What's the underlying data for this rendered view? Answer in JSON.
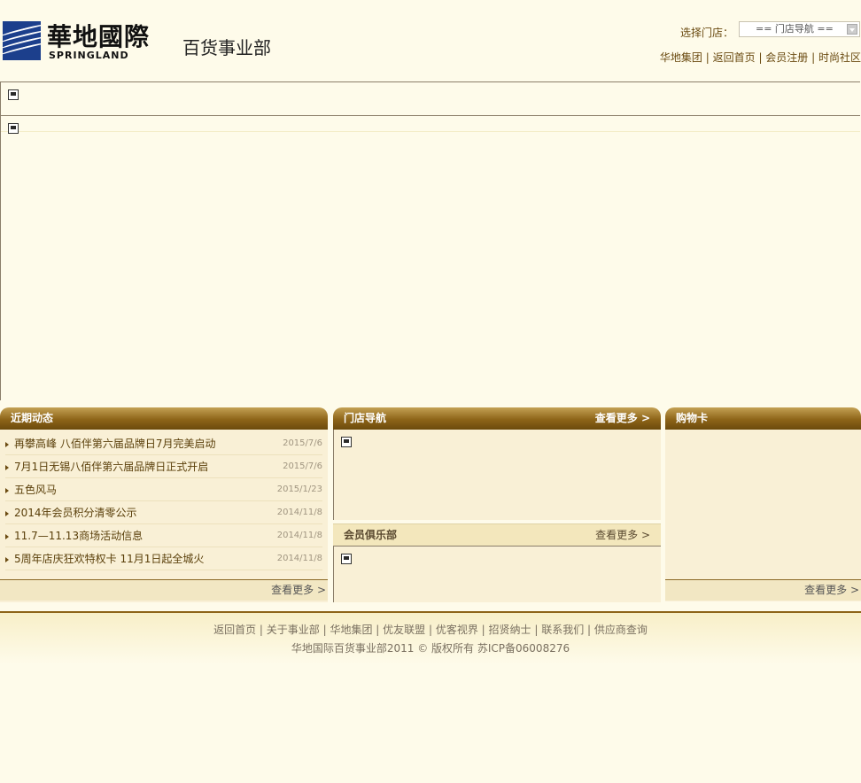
{
  "header": {
    "logo_cn": "華地國際",
    "logo_en": "SPRINGLAND",
    "dept_title": "百货事业部",
    "store_select_label": "选择门店：",
    "store_select_value": "==  门店导航  ==",
    "top_links": [
      "华地集团",
      "返回首页",
      "会员注册",
      "时尚社区"
    ]
  },
  "recent_news": {
    "title": "近期动态",
    "items": [
      {
        "title": "再攀高峰 八佰伴第六届品牌日7月完美启动",
        "date": "2015/7/6"
      },
      {
        "title": "7月1日无锡八佰伴第六届品牌日正式开启",
        "date": "2015/7/6"
      },
      {
        "title": "五色风马",
        "date": "2015/1/23"
      },
      {
        "title": "2014年会员积分清零公示",
        "date": "2014/11/8"
      },
      {
        "title": "11.7—11.13商场活动信息",
        "date": "2014/11/8"
      },
      {
        "title": "5周年店庆狂欢特权卡 11月1日起全城火",
        "date": "2014/11/8"
      }
    ],
    "more": "查看更多 >"
  },
  "store_nav": {
    "title": "门店导航",
    "more": "查看更多 >"
  },
  "member_club": {
    "title": "会员俱乐部",
    "more": "查看更多 >"
  },
  "shopping_card": {
    "title": "购物卡",
    "more": "查看更多 >"
  },
  "footer": {
    "links": [
      "返回首页",
      "关于事业部",
      "华地集团",
      "优友联盟",
      "优客视界",
      "招贤纳士",
      "联系我们",
      "供应商查询"
    ],
    "copyright": "华地国际百货事业部2011 © 版权所有 苏ICP备06008276"
  },
  "colors": {
    "accent": "#8d6418",
    "background": "#fefbea",
    "panel_bg": "#f9f0d6"
  }
}
